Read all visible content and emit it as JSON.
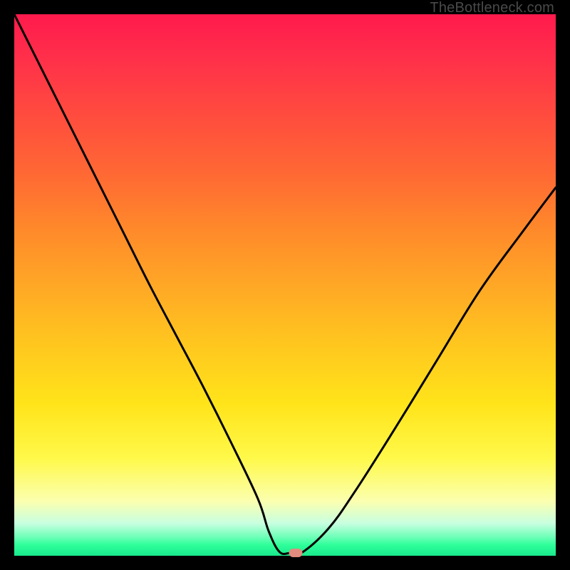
{
  "attribution": "TheBottleneck.com",
  "colors": {
    "frame": "#000000",
    "attribution_text": "#4a4a4a",
    "curve_stroke": "#000000",
    "marker_fill": "#e38b7e",
    "gradient_stops": [
      {
        "offset": 0,
        "color": "#ff1a4d"
      },
      {
        "offset": 0.08,
        "color": "#ff2f4a"
      },
      {
        "offset": 0.18,
        "color": "#ff4a3f"
      },
      {
        "offset": 0.3,
        "color": "#ff6a33"
      },
      {
        "offset": 0.4,
        "color": "#ff8a2a"
      },
      {
        "offset": 0.5,
        "color": "#ffa726"
      },
      {
        "offset": 0.6,
        "color": "#ffc41f"
      },
      {
        "offset": 0.72,
        "color": "#ffe41a"
      },
      {
        "offset": 0.82,
        "color": "#fff94a"
      },
      {
        "offset": 0.9,
        "color": "#fbffb0"
      },
      {
        "offset": 0.94,
        "color": "#c8ffe0"
      },
      {
        "offset": 0.965,
        "color": "#6fffb8"
      },
      {
        "offset": 0.98,
        "color": "#2fff9a"
      },
      {
        "offset": 1.0,
        "color": "#18e98c"
      }
    ]
  },
  "chart_data": {
    "type": "line",
    "title": "",
    "xlabel": "",
    "ylabel": "",
    "xlim": [
      0,
      100
    ],
    "ylim": [
      0,
      100
    ],
    "annotations": [
      {
        "text": "TheBottleneck.com",
        "position": "top-right"
      }
    ],
    "series": [
      {
        "name": "bottleneck-curve",
        "x": [
          0,
          5,
          10,
          15,
          20,
          25,
          30,
          35,
          40,
          45,
          47,
          49,
          51,
          53,
          58,
          63,
          70,
          78,
          86,
          94,
          100
        ],
        "y": [
          100,
          90,
          80,
          70,
          60,
          50,
          40.5,
          31,
          21,
          10.5,
          4.5,
          0.7,
          0.5,
          0.5,
          5,
          12,
          23,
          36,
          49,
          60,
          68
        ]
      },
      {
        "name": "optimum-marker",
        "type": "scatter",
        "x": [
          52
        ],
        "y": [
          0.5
        ]
      }
    ]
  }
}
